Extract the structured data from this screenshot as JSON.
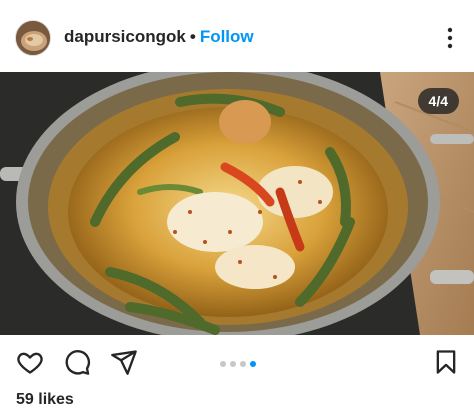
{
  "post": {
    "username": "dapursicongok",
    "separator": "•",
    "follow_label": "Follow",
    "counter": "4/4",
    "likes": "59 likes",
    "carousel": {
      "total": 4,
      "current": 4
    }
  },
  "icons": {
    "like": "heart-icon",
    "comment": "comment-icon",
    "share": "paper-plane-icon",
    "save": "bookmark-icon",
    "more": "more-options-icon"
  },
  "colors": {
    "accent": "#0095f6",
    "text": "#262626",
    "dot_inactive": "#c7c7c7"
  }
}
